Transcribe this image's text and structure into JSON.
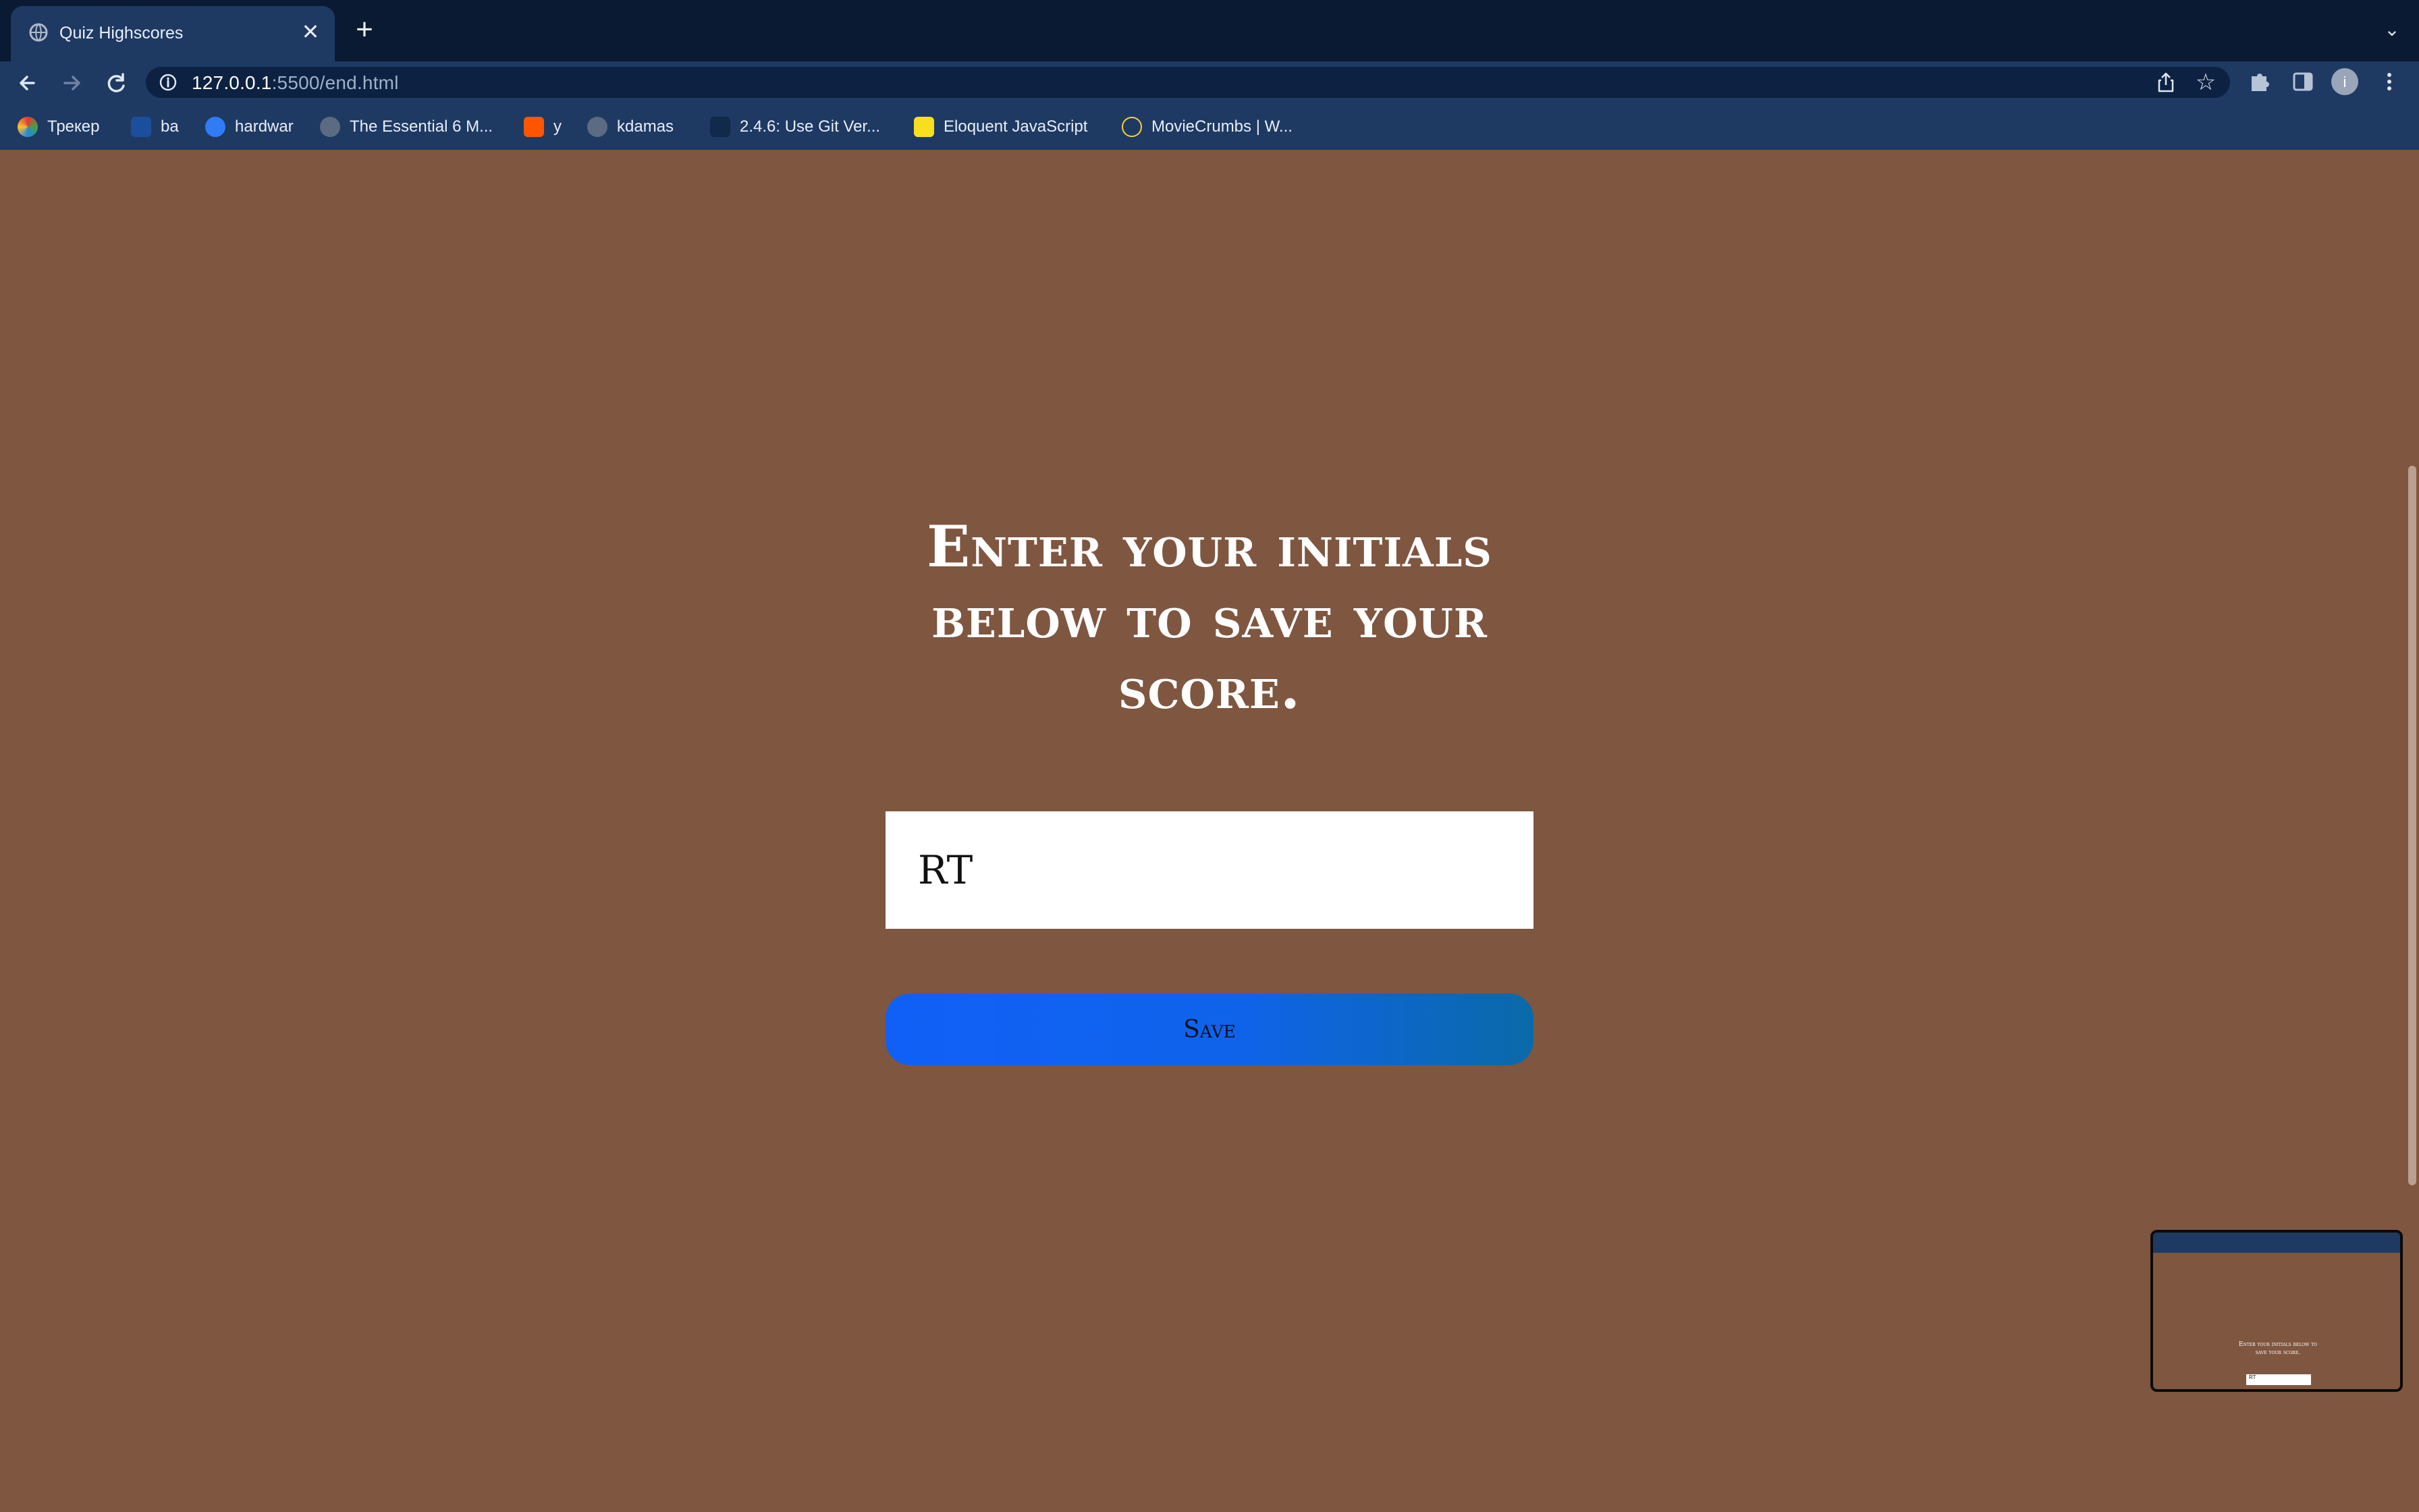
{
  "browser": {
    "tab_title": "Quiz Highscores",
    "tab_close": "✕",
    "new_tab": "+",
    "tab_list": "⌄",
    "url_host": "127.0.0.1",
    "url_path": ":5500/end.html",
    "accent": "#1e3a63",
    "bookmarks": [
      {
        "label": "Трекер",
        "icon": "tracker-icon"
      },
      {
        "label": "ba",
        "icon": "uci-icon"
      },
      {
        "label": "hardwar",
        "icon": "gear-icon"
      },
      {
        "label": "The Essential 6 M...",
        "icon": "globe-icon"
      },
      {
        "label": "y",
        "icon": "soundcloud-icon"
      },
      {
        "label": "kdamas",
        "icon": "globe-icon"
      },
      {
        "label": "2.4.6: Use Git Ver...",
        "icon": "course-icon"
      },
      {
        "label": "Eloquent JavaScript",
        "icon": "ejs-icon"
      },
      {
        "label": "MovieCrumbs | W...",
        "icon": "moviecrumbs-icon"
      }
    ]
  },
  "page": {
    "heading": "Enter your initials below to save your score.",
    "initials_value": "RT",
    "save_label": "Save",
    "background": "#7f5640"
  },
  "thumbnail": {
    "heading": "Enter your initials below to save your score.",
    "initials_value": "RT"
  }
}
